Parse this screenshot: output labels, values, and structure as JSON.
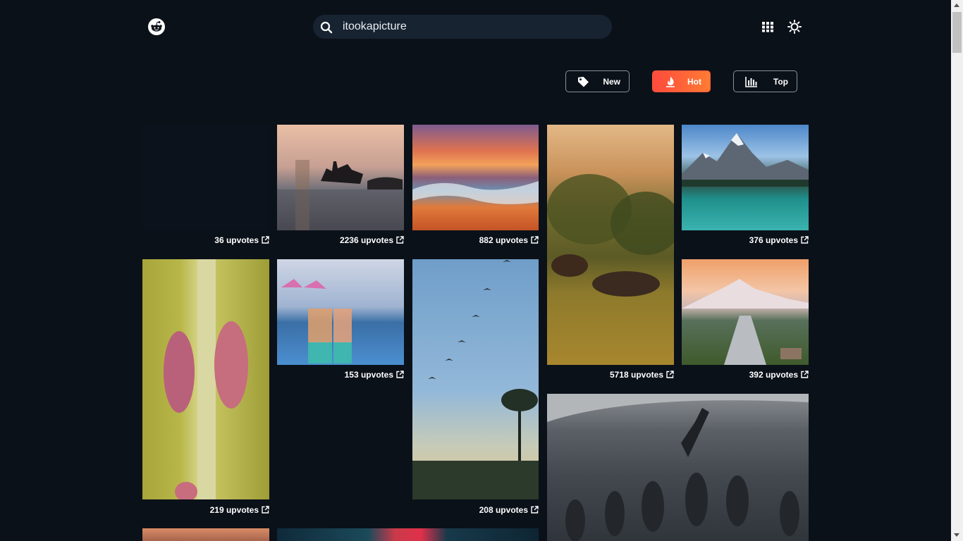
{
  "header": {
    "logo_icon": "reddit-alien-icon",
    "search": {
      "value": "itookapicture",
      "placeholder": ""
    },
    "grid_icon": "grid-icon",
    "theme_icon": "sun-icon"
  },
  "sort": {
    "new_label": "New",
    "hot_label": "Hot",
    "top_label": "Top",
    "active": "Hot",
    "accent": "#ff5a3a"
  },
  "posts": [
    {
      "upvotes": "36 upvotes",
      "subject": "dark-blank"
    },
    {
      "upvotes": "2236 upvotes",
      "subject": "shipwreck"
    },
    {
      "upvotes": "882 upvotes",
      "subject": "sunset-wave"
    },
    {
      "upvotes": "5718 upvotes",
      "subject": "bison-meadow"
    },
    {
      "upvotes": "376 upvotes",
      "subject": "mountain-lake"
    },
    {
      "upvotes": "219 upvotes",
      "subject": "caterpillars"
    },
    {
      "upvotes": "153 upvotes",
      "subject": "cocktails"
    },
    {
      "upvotes": "208 upvotes",
      "subject": "palms-birds"
    },
    {
      "upvotes": "392 upvotes",
      "subject": "mountain-town"
    },
    {
      "upvotes": "",
      "subject": "underwater-diver"
    },
    {
      "upvotes": "",
      "subject": "sunset-partial"
    },
    {
      "upvotes": "",
      "subject": "red-fish-partial"
    }
  ],
  "icons": {
    "external_link": "external-link-icon"
  }
}
